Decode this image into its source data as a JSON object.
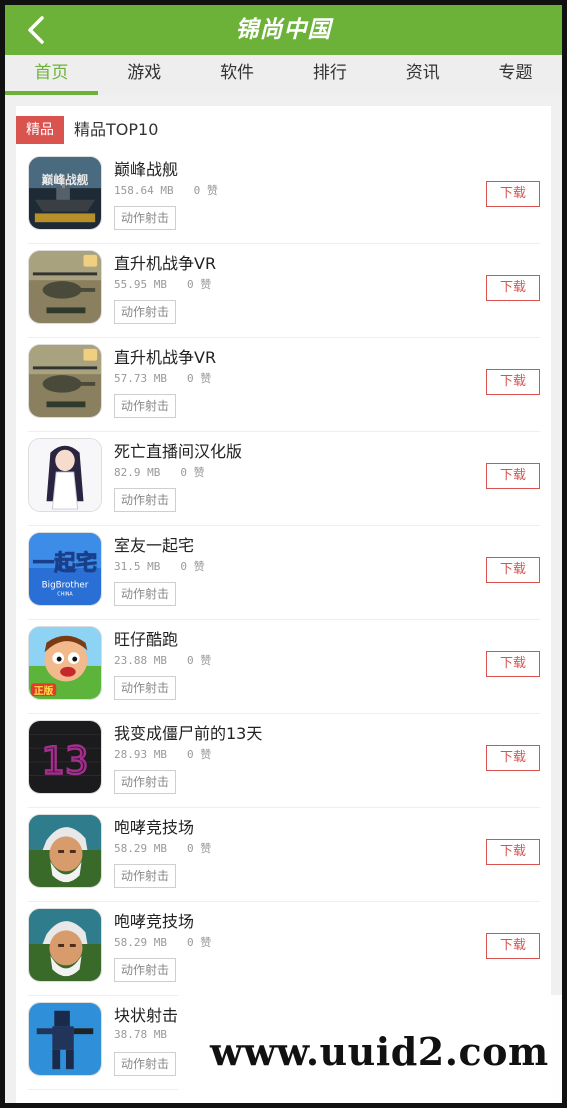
{
  "header": {
    "title": "锦尚中国"
  },
  "tabs": [
    {
      "label": "首页"
    },
    {
      "label": "游戏"
    },
    {
      "label": "软件"
    },
    {
      "label": "排行"
    },
    {
      "label": "资讯"
    },
    {
      "label": "专题"
    }
  ],
  "section": {
    "badge": "精品",
    "title": "精品TOP10"
  },
  "apps": [
    {
      "name": "巅峰战舰",
      "size": "158.64 MB",
      "likes": "0 赞",
      "tag": "动作射击",
      "download": "下载"
    },
    {
      "name": "直升机战争VR",
      "size": "55.95 MB",
      "likes": "0 赞",
      "tag": "动作射击",
      "download": "下载"
    },
    {
      "name": "直升机战争VR",
      "size": "57.73 MB",
      "likes": "0 赞",
      "tag": "动作射击",
      "download": "下载"
    },
    {
      "name": "死亡直播间汉化版",
      "size": "82.9 MB",
      "likes": "0 赞",
      "tag": "动作射击",
      "download": "下载"
    },
    {
      "name": "室友一起宅",
      "size": "31.5 MB",
      "likes": "0 赞",
      "tag": "动作射击",
      "download": "下载"
    },
    {
      "name": "旺仔酷跑",
      "size": "23.88 MB",
      "likes": "0 赞",
      "tag": "动作射击",
      "download": "下载"
    },
    {
      "name": "我变成僵尸前的13天",
      "size": "28.93 MB",
      "likes": "0 赞",
      "tag": "动作射击",
      "download": "下载"
    },
    {
      "name": "咆哮竞技场",
      "size": "58.29 MB",
      "likes": "0 赞",
      "tag": "动作射击",
      "download": "下载"
    },
    {
      "name": "咆哮竞技场",
      "size": "58.29 MB",
      "likes": "0 赞",
      "tag": "动作射击",
      "download": "下载"
    },
    {
      "name": "块状射击",
      "size": "38.78 MB",
      "likes": "",
      "tag": "动作射击",
      "download": ""
    }
  ],
  "icons": [
    "warship-game-icon",
    "helicopter-game-icon",
    "helicopter-game-icon",
    "anime-girl-game-icon",
    "roommate-game-icon",
    "runner-boy-game-icon",
    "zombie-13-game-icon",
    "old-fighter-game-icon",
    "old-fighter-game-icon",
    "block-shooter-game-icon"
  ],
  "colors": {
    "brand_green": "#6cb238",
    "accent_red": "#d9534f"
  },
  "watermark": {
    "text": "www.uuid2.com"
  }
}
